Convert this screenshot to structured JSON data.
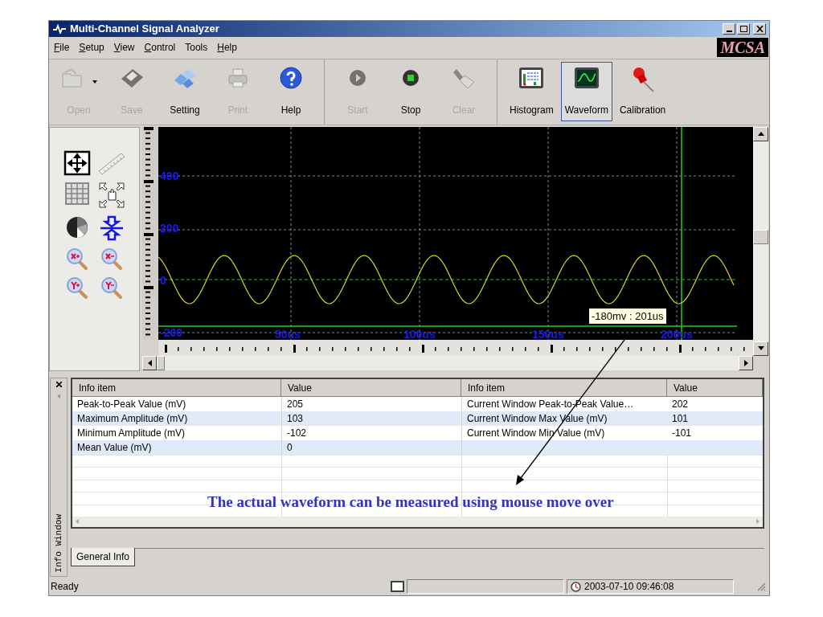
{
  "window": {
    "title": "Multi-Channel Signal Analyzer"
  },
  "menu": [
    {
      "label": "File",
      "mnemonic": true
    },
    {
      "label": "Setup",
      "mnemonic": true
    },
    {
      "label": "View",
      "mnemonic": true
    },
    {
      "label": "Control",
      "mnemonic": true
    },
    {
      "label": "Tools",
      "mnemonic": false
    },
    {
      "label": "Help",
      "mnemonic": true
    }
  ],
  "logo": "MCSA",
  "toolbar": [
    [
      {
        "label": "Open",
        "disabled": true,
        "selected": false,
        "dropdown": true
      },
      {
        "label": "Save",
        "disabled": true,
        "selected": false,
        "dropdown": false
      },
      {
        "label": "Setting",
        "disabled": false,
        "selected": false,
        "dropdown": false
      },
      {
        "label": "Print",
        "disabled": true,
        "selected": false,
        "dropdown": false
      },
      {
        "label": "Help",
        "disabled": false,
        "selected": false,
        "dropdown": false
      }
    ],
    [
      {
        "label": "Start",
        "disabled": true,
        "selected": false,
        "dropdown": false
      },
      {
        "label": "Stop",
        "disabled": false,
        "selected": false,
        "dropdown": false
      },
      {
        "label": "Clear",
        "disabled": true,
        "selected": false,
        "dropdown": false
      }
    ],
    [
      {
        "label": "Histogram",
        "disabled": false,
        "selected": false,
        "dropdown": false
      },
      {
        "label": "Waveform",
        "disabled": false,
        "selected": true,
        "dropdown": false
      },
      {
        "label": "Calibration",
        "disabled": false,
        "selected": false,
        "dropdown": false
      }
    ]
  ],
  "plot": {
    "y_labels": [
      "400",
      "200",
      "0",
      "-200"
    ],
    "x_labels": [
      "50us",
      "100us",
      "150us",
      "200us"
    ],
    "readout": "-180mv : 201us"
  },
  "info_table": {
    "columns": [
      "Info item",
      "Value",
      "Info item",
      "Value"
    ],
    "rows": [
      [
        "Peak-to-Peak Value (mV)",
        "205",
        "Current Window Peak-to-Peak Value…",
        "202"
      ],
      [
        "Maximum Amplitude (mV)",
        "103",
        "Current Window Max Value (mV)",
        "101"
      ],
      [
        "Minimum Amplitude (mV)",
        "-102",
        "Current Window Min Value (mV)",
        "-101"
      ],
      [
        "Mean Value (mV)",
        "0"
      ]
    ]
  },
  "side_tab": "Info Window",
  "tabs": [
    {
      "label": "General Info",
      "selected": true
    }
  ],
  "annotation": "The actual waveform can be measured using mouse move over",
  "status_bar": {
    "text": "Ready",
    "datetime": "2003-07-10 09:46:08"
  }
}
